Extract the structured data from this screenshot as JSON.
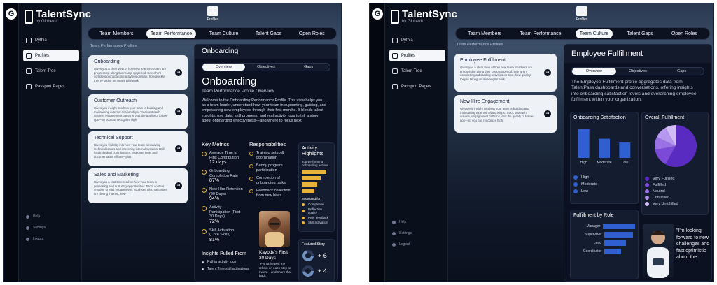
{
  "brand": {
    "name": "TalentSync",
    "sub": "by Globekit"
  },
  "sidebar": {
    "items": [
      "Pythia",
      "Profiles",
      "Talent Tree",
      "Passport Pages"
    ],
    "bottom": [
      "Help",
      "Settings",
      "Logout"
    ]
  },
  "top": {
    "profiles_label": "Profiles"
  },
  "tabs": [
    "Team Members",
    "Team Performance",
    "Team Culture",
    "Talent Gaps",
    "Open Roles"
  ],
  "colors": {
    "accent": "#e9b23a",
    "bar_blue": "#2f5fd0",
    "purple": "#5a2bc0"
  },
  "screen1": {
    "section_title": "Team Performance Profiles",
    "cards": [
      {
        "title": "Onboarding",
        "desc": "Gives you a clear view of how new team members are progressing along their ramp-up period. See who's completing onboarding activities on time, how quickly they're taking on meaningful work."
      },
      {
        "title": "Customer Outreach",
        "desc": "Gives you insight into how your team is building and maintaining external relationships. Track outreach volume, engagement patterns, and the quality of follow-ups—so you can recognize high"
      },
      {
        "title": "Technical Support",
        "desc": "Gives you visibility into how your team is resolving technical issues and improving internal systems. Drill into individual contributions, response time, and documentation efforts—plus"
      },
      {
        "title": "Sales and Marketing",
        "desc": "Gives you a real-time read on how your team is generating and nurturing opportunities. From content creation to lead engagement, you'll see which activities are driving interest, how"
      }
    ],
    "panel": {
      "title": "Onboarding",
      "seg": [
        "Overview",
        "Objectives",
        "Gaps"
      ],
      "heading": "Onboarding",
      "subheading": "Team Performance Profile Overview",
      "intro": "Welcome to the Onboarding Performance Profile. This view helps you, as a team leader, understand how your team in supporting, guiding, and empowering new employees through their first months. It blends talent insights, role data, skill progress, and real activity logs to tell a story about onboarding effectiveness—and where to focus next.",
      "key_metrics_title": "Key Metrics",
      "metrics": [
        {
          "label": "Average Time to First Contribution",
          "value": "12 days"
        },
        {
          "label": "Onboarding Completion Rate",
          "value": "87%"
        },
        {
          "label": "New Hire Retention (90 Days)",
          "value": "94%"
        },
        {
          "label": "Activity Participation (First 30 Days)",
          "value": "72%"
        },
        {
          "label": "Skill Activation (Core Skills)",
          "value": "81%"
        }
      ],
      "responsibilities_title": "Responsibilities",
      "responsibilities": [
        "Training setup & coordination",
        "Buddy program participation",
        "Completion of onboarding tasks",
        "Feedback collection from new hires"
      ],
      "activity_title": "Activity Highlights",
      "activity_sub": "Top-performing onboarding actions",
      "activity_bars": [
        0.8,
        0.62,
        0.5,
        0.4
      ],
      "measured_for": "Measured for:",
      "measures": [
        "Completion",
        "Reflection quality",
        "Peer feedback",
        "Skill activation"
      ],
      "insights_title": "Insights Pulled From",
      "insights": [
        "Pythia activity logs",
        "Talent Tree skill activations"
      ],
      "story_title": "Kayode's First 30 Days",
      "story_quote": "\"Pythia helped me reflect on each step as I went—and share that back\"",
      "featured_title": "Featured Story",
      "featured_vals": [
        "+ 6",
        "+ 4"
      ]
    }
  },
  "screen2": {
    "section_title": "Team Performance Profiles",
    "cards": [
      {
        "title": "Employee Fulfillment",
        "desc": "Gives you a clear view of how new team members are progressing along their ramp-up period. See who's completing onboarding activities on time, how quickly they're taking on meaningful work."
      },
      {
        "title": "New Hire Engagement",
        "desc": "Gives you insight into how your team is building and maintaining external relationships. Track outreach volume, engagement patterns, and the quality of follow-ups—so you can recognize high"
      }
    ],
    "panel": {
      "title": "Employee Fulfillment",
      "seg": [
        "Overview",
        "Objectives",
        "Gaps"
      ],
      "intro": "The Employee Fulfillment profile aggregates data from TalentPass dashboards and conversations, offering insights into onboarding satisfaction levels and overarching employee fulfillment within your organization.",
      "sat_title": "Onboarding Satisfaction",
      "sat_legend": [
        "High",
        "Moderate",
        "Low"
      ],
      "overall_title": "Overall Fulfillment",
      "overall_legend": [
        "Very Fulfilled",
        "Fulfilled",
        "Neutral",
        "Unfulfilled",
        "Very Unfulfilled"
      ],
      "role_title": "Fulfillment by Role",
      "quote": "\"I'm looking forward to new challenges and fast optimistic about the"
    }
  },
  "chart_data": [
    {
      "type": "bar",
      "categories": [
        "High",
        "Moderate",
        "Low"
      ],
      "values": [
        3,
        2,
        1.6
      ],
      "title": "Onboarding Satisfaction",
      "ylim": [
        0,
        3.5
      ]
    },
    {
      "type": "pie",
      "categories": [
        "Very Fulfilled",
        "Fulfilled",
        "Neutral",
        "Unfulfilled",
        "Very Unfulfilled"
      ],
      "values": [
        58,
        14,
        10,
        10,
        8
      ],
      "title": "Overall Fulfillment"
    },
    {
      "type": "bar",
      "categories": [
        "Manager",
        "Supervisor",
        "Lead",
        "Coordinator"
      ],
      "values": [
        100,
        85,
        65,
        50
      ],
      "title": "Fulfillment by Role",
      "orientation": "horizontal"
    }
  ]
}
